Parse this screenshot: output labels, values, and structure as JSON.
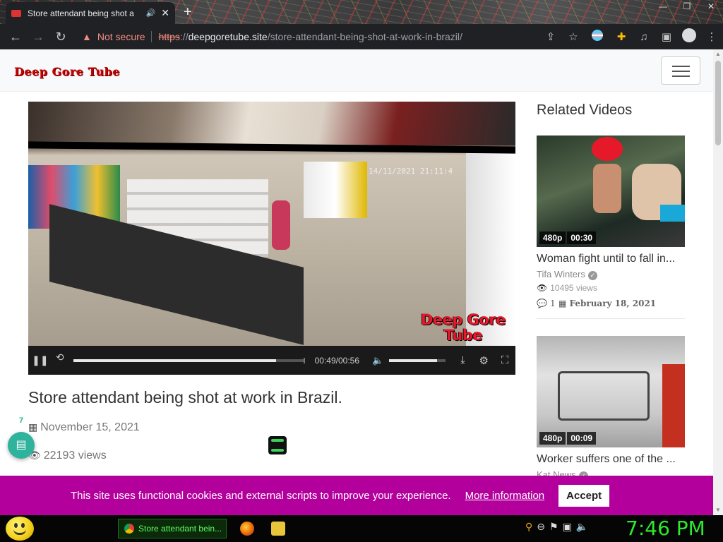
{
  "browser": {
    "tab_title": "Store attendant being shot a",
    "new_tab": "+",
    "security_label": "Not secure",
    "url_scheme": "https",
    "url_separator": "://",
    "url_host": "deepgoretube.site",
    "url_path": "/store-attendant-being-shot-at-work-in-brazil/"
  },
  "site": {
    "logo": "Deep Gore Tube"
  },
  "video": {
    "time": "00:49/00:56",
    "progress": 0.875,
    "volume": 0.85,
    "timestamp_overlay": "14/11/2021  21:11:4",
    "watermark_line1": "Deep Gore",
    "watermark_line2": "Tube",
    "title": "Store attendant being shot at work in Brazil.",
    "date": "November 15, 2021",
    "views": "22193 views"
  },
  "related": {
    "heading": "Related Videos",
    "items": [
      {
        "quality": "480p",
        "duration": "00:30",
        "title": "Woman fight until to fall in...",
        "author": "Tifa Winters",
        "views": "10495 views",
        "comments": "1",
        "date": "February 18, 2021"
      },
      {
        "quality": "480p",
        "duration": "00:09",
        "title": "Worker suffers one of the ...",
        "author": "Kat News"
      }
    ]
  },
  "chat": {
    "count": "7"
  },
  "cookie": {
    "message": "This site uses functional cookies and external scripts to improve your experience.",
    "more_info": "More information",
    "accept": "Accept"
  },
  "taskbar": {
    "active_window": "Store attendant bein...",
    "clock": "7:46 PM"
  },
  "colors": {
    "cookie_bar": "#b3009d",
    "clock": "#2ee82e",
    "insecure": "#f28b82"
  }
}
